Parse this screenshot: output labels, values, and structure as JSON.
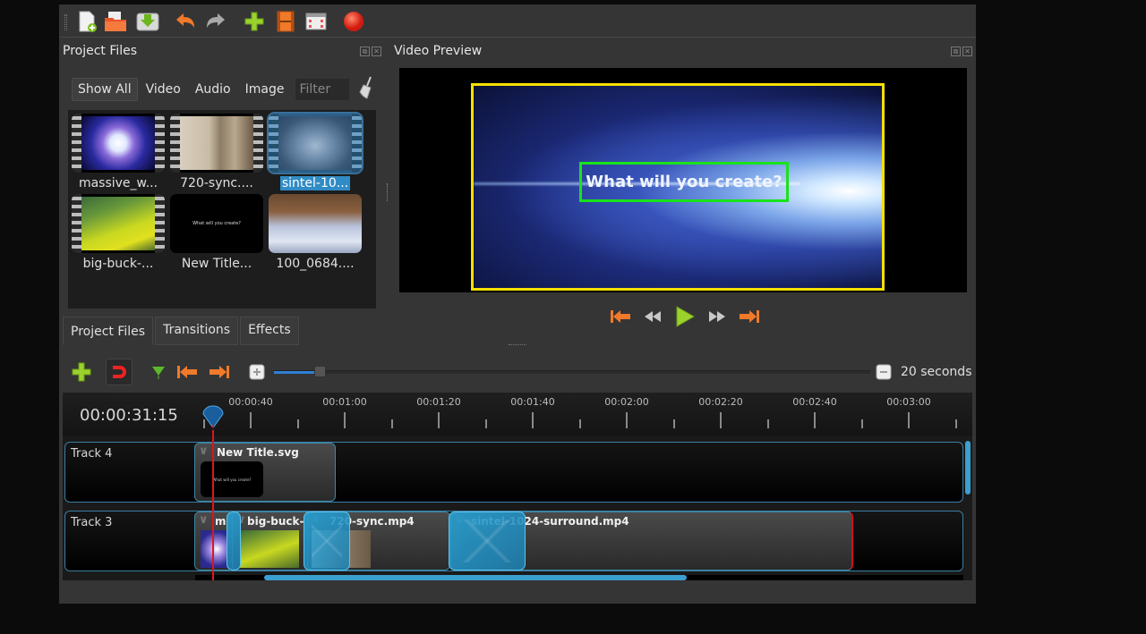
{
  "toolbar": {
    "buttons": [
      {
        "name": "new-project",
        "icon": "new-file-icon"
      },
      {
        "name": "open-project",
        "icon": "open-folder-icon"
      },
      {
        "name": "save-project",
        "icon": "save-icon"
      },
      {
        "name": "undo",
        "icon": "undo-icon"
      },
      {
        "name": "redo",
        "icon": "redo-icon"
      },
      {
        "name": "import-files",
        "icon": "plus-icon"
      },
      {
        "name": "profile",
        "icon": "film-icon"
      },
      {
        "name": "fullscreen",
        "icon": "fullscreen-icon"
      },
      {
        "name": "export-video",
        "icon": "record-icon"
      }
    ]
  },
  "project_files": {
    "title": "Project Files",
    "filters": [
      "Show All",
      "Video",
      "Audio",
      "Image"
    ],
    "active_filter": "Show All",
    "filter_placeholder": "Filter",
    "filter_value": "",
    "files": [
      {
        "label": "massive_w...",
        "type": "video",
        "selected": false
      },
      {
        "label": "720-sync....",
        "type": "video",
        "selected": false
      },
      {
        "label": "sintel-10...",
        "type": "video",
        "selected": true
      },
      {
        "label": "big-buck-...",
        "type": "video",
        "selected": false
      },
      {
        "label": "New Title...",
        "type": "title",
        "selected": false,
        "thumb_text": "What will you create?"
      },
      {
        "label": "100_0684....",
        "type": "image",
        "selected": false
      }
    ]
  },
  "dock_tabs": [
    "Project Files",
    "Transitions",
    "Effects"
  ],
  "active_dock_tab": "Project Files",
  "video_preview": {
    "title": "Video Preview",
    "overlay_text": "What will you create?",
    "frame_color": "#f5e000",
    "title_box_color": "#19e31b"
  },
  "transport": [
    {
      "name": "jump-start",
      "icon": "jump-start-icon"
    },
    {
      "name": "rewind",
      "icon": "rewind-icon"
    },
    {
      "name": "play",
      "icon": "play-icon"
    },
    {
      "name": "fast-forward",
      "icon": "fast-forward-icon"
    },
    {
      "name": "jump-end",
      "icon": "jump-end-icon"
    }
  ],
  "timeline_toolbar": {
    "zoom_label": "20 seconds",
    "zoom_fraction": 0.07
  },
  "timeline": {
    "timecode": "00:00:31:15",
    "ticks": [
      "00:00:40",
      "00:01:00",
      "00:01:20",
      "00:01:40",
      "00:02:00",
      "00:02:20",
      "00:02:40",
      "00:03:00"
    ],
    "tracks": [
      {
        "name": "Track 4",
        "clips": [
          {
            "title": "New Title.svg"
          }
        ]
      },
      {
        "name": "Track 3",
        "clips": [
          {
            "title": "m"
          },
          {
            "title": "big-buck-"
          },
          {
            "title": "720-sync.mp4"
          },
          {
            "title": "sintel-1024-surround.mp4"
          }
        ]
      }
    ],
    "hscroll_start": 0.09,
    "hscroll_end": 0.64
  },
  "colors": {
    "accent_blue": "#308cc6",
    "playhead": "#e0141e",
    "track_border": "#3a7ea3"
  }
}
